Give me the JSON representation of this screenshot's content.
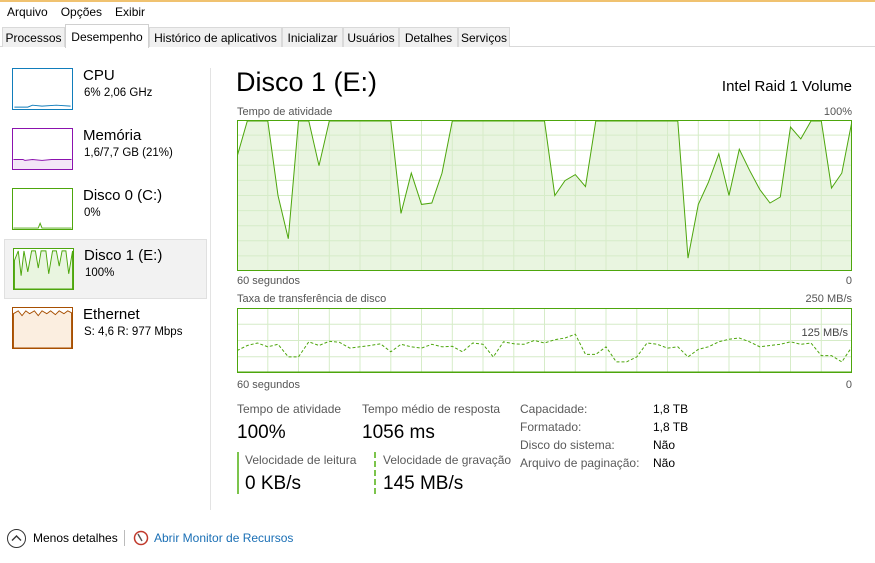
{
  "menu": [
    "Arquivo",
    "Opções",
    "Exibir"
  ],
  "tabs": [
    "Processos",
    "Desempenho",
    "Histórico de aplicativos",
    "Inicializar",
    "Usuários",
    "Detalhes",
    "Serviços"
  ],
  "active_tab": "Desempenho",
  "sidebar": [
    {
      "name": "CPU",
      "value": "6% 2,06 GHz",
      "color": "#117dbb",
      "icon": "cpu-graph-icon"
    },
    {
      "name": "Memória",
      "value": "1,6/7,7 GB (21%)",
      "color": "#8b12ae",
      "icon": "memory-graph-icon"
    },
    {
      "name": "Disco 0 (C:)",
      "value": "0%",
      "color": "#4da60c",
      "icon": "disk-graph-icon"
    },
    {
      "name": "Disco 1 (E:)",
      "value": "100%",
      "color": "#4da60c",
      "icon": "disk-graph-icon"
    },
    {
      "name": "Ethernet",
      "value": "S: 4,6 R: 977 Mbps",
      "color": "#a74f01",
      "icon": "ethernet-graph-icon"
    }
  ],
  "header": {
    "title": "Disco 1 (E:)",
    "device": "Intel Raid 1 Volume"
  },
  "graph1": {
    "label": "Tempo de atividade",
    "max_label": "100%",
    "time_label": "60 segundos",
    "min_label": "0"
  },
  "graph2": {
    "label": "Taxa de transferência de disco",
    "max_label": "250 MB/s",
    "mid_label": "125 MB/s",
    "time_label": "60 segundos",
    "min_label": "0"
  },
  "chart_data": [
    {
      "type": "area",
      "title": "Tempo de atividade",
      "xlabel": "60 segundos",
      "ylim": [
        0,
        100
      ],
      "unit": "%",
      "x": [
        60,
        59,
        58,
        57,
        56,
        55,
        54,
        53,
        52,
        51,
        50,
        49,
        48,
        47,
        46,
        45,
        44,
        43,
        42,
        41,
        40,
        39,
        38,
        37,
        36,
        35,
        34,
        33,
        32,
        31,
        30,
        29,
        28,
        27,
        26,
        25,
        24,
        23,
        22,
        21,
        20,
        19,
        18,
        17,
        16,
        15,
        14,
        13,
        12,
        11,
        10,
        9,
        8,
        7,
        6,
        5,
        4,
        3,
        2,
        1,
        0
      ],
      "values": [
        76,
        100,
        100,
        100,
        50,
        21,
        100,
        100,
        70,
        100,
        100,
        100,
        100,
        100,
        100,
        100,
        38,
        65,
        44,
        45,
        65,
        100,
        100,
        100,
        100,
        100,
        100,
        100,
        100,
        100,
        100,
        50,
        60,
        64,
        56,
        100,
        100,
        100,
        100,
        100,
        100,
        100,
        100,
        100,
        8,
        44,
        59,
        78,
        50,
        81,
        67,
        54,
        45,
        49,
        96,
        88,
        100,
        100,
        55,
        65,
        100
      ],
      "fill": "#e9f5e0",
      "stroke": "#4da60c",
      "grid": true
    },
    {
      "type": "line",
      "title": "Taxa de transferência de disco",
      "xlabel": "60 segundos",
      "ylim": [
        0,
        250
      ],
      "unit": "MB/s",
      "grid": true,
      "series": [
        {
          "name": "Velocidade de leitura",
          "style": "solid",
          "color": "#4da60c",
          "values": [
            0,
            0,
            0,
            0,
            0,
            0,
            0,
            0,
            0,
            0,
            0,
            0,
            0,
            0,
            0,
            0,
            0,
            0,
            0,
            0,
            0,
            0,
            0,
            0,
            0,
            0,
            0,
            0,
            0,
            0,
            0,
            0,
            0,
            0,
            0,
            0,
            0,
            0,
            0,
            0,
            0,
            0,
            0,
            0,
            0,
            0,
            0,
            0,
            0,
            0,
            0,
            0,
            0,
            0,
            0,
            0,
            0,
            0,
            0,
            0,
            0
          ]
        },
        {
          "name": "Velocidade de gravação",
          "style": "dashed",
          "color": "#4da60c",
          "values": [
            85,
            105,
            115,
            100,
            110,
            60,
            60,
            120,
            105,
            122,
            118,
            95,
            100,
            105,
            112,
            80,
            110,
            100,
            95,
            110,
            100,
            102,
            80,
            115,
            110,
            60,
            120,
            112,
            110,
            125,
            115,
            128,
            135,
            150,
            70,
            70,
            100,
            40,
            40,
            60,
            115,
            110,
            95,
            100,
            60,
            90,
            100,
            120,
            130,
            135,
            120,
            100,
            105,
            110,
            120,
            110,
            115,
            65,
            65,
            40,
            100
          ]
        }
      ]
    }
  ],
  "stats": {
    "activity_label": "Tempo de atividade",
    "activity_value": "100%",
    "response_label": "Tempo médio de resposta",
    "response_value": "1056 ms",
    "read_label": "Velocidade de leitura",
    "read_value": "0 KB/s",
    "write_label": "Velocidade de gravação",
    "write_value": "145 MB/s"
  },
  "specs": [
    {
      "label": "Capacidade:",
      "value": "1,8 TB"
    },
    {
      "label": "Formatado:",
      "value": "1,8 TB"
    },
    {
      "label": "Disco do sistema:",
      "value": "Não"
    },
    {
      "label": "Arquivo de paginação:",
      "value": "Não"
    }
  ],
  "footer": {
    "less_details": "Menos detalhes",
    "open_monitor": "Abrir Monitor de Recursos",
    "link_color": "#1a6fb5"
  }
}
